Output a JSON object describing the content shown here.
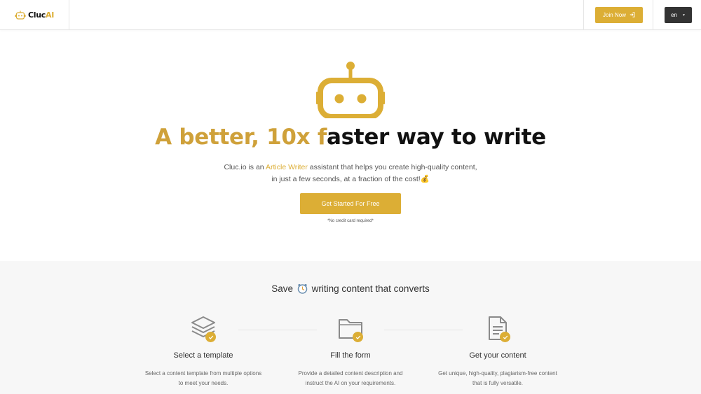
{
  "header": {
    "logo": {
      "text_main": "Cluc",
      "text_accent": "AI"
    },
    "join_label": "Join Now",
    "lang_label": "en"
  },
  "hero": {
    "title_gold": "A better, 10x f",
    "title_dark": "aster way to write",
    "subtitle_pre": "Cluc.io is an ",
    "subtitle_link": "Article Writer",
    "subtitle_post": " assistant that helps you create high-quality content,",
    "subtitle_line2": "in just a few seconds, at a fraction of the cost!💰",
    "cta_label": "Get Started For Free",
    "note": "*No credit card required*"
  },
  "steps": {
    "title_pre": "Save",
    "title_post": "writing content that converts",
    "items": [
      {
        "icon": "layers-icon",
        "title": "Select a template",
        "desc1": "Select a content template from multiple options",
        "desc2": "to meet your needs."
      },
      {
        "icon": "folder-icon",
        "title": "Fill the form",
        "desc1": "Provide a detailed content description and",
        "desc2": "instruct the AI on your requirements."
      },
      {
        "icon": "document-icon",
        "title": "Get your content",
        "desc1": "Get unique, high-quality, plagiarism-free content",
        "desc2": "that is fully versatile."
      }
    ]
  },
  "colors": {
    "accent": "#dcae35",
    "dark": "#333333",
    "section_bg": "#f7f7f7"
  }
}
